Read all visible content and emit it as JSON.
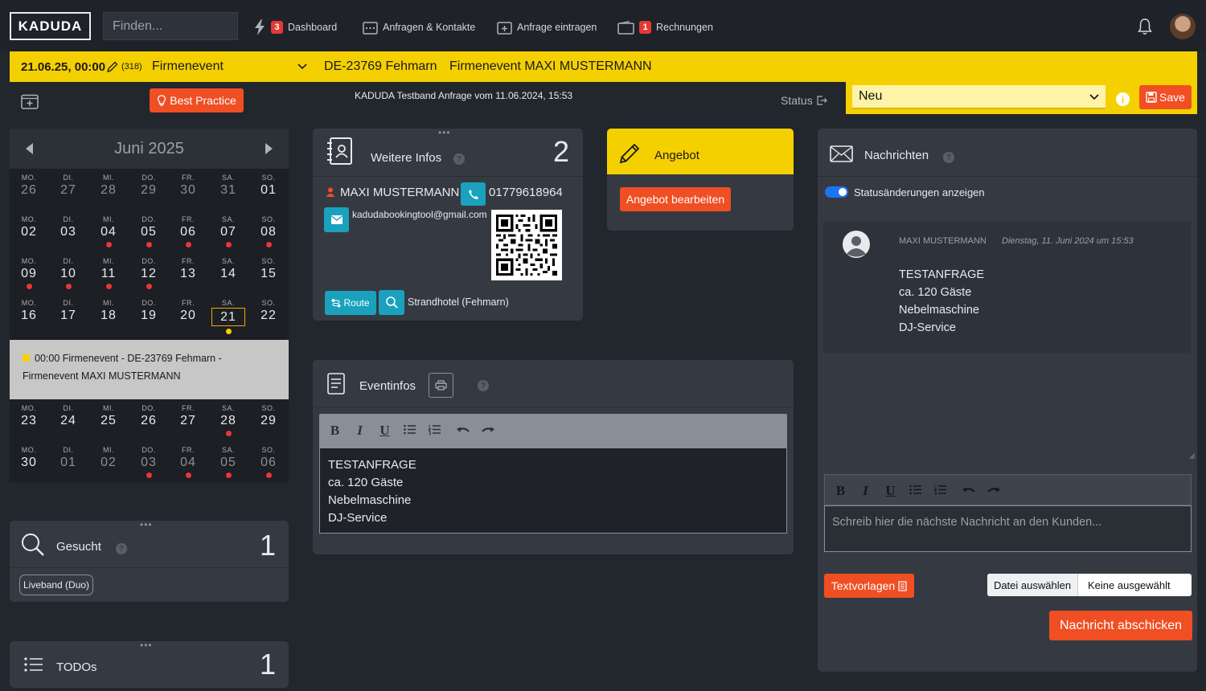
{
  "nav": {
    "logo": "KADUDA",
    "search_placeholder": "Finden...",
    "dashboard_label": "Dashboard",
    "dashboard_badge": "3",
    "anfragen_label": "Anfragen & Kontakte",
    "anfrage_eintragen_label": "Anfrage eintragen",
    "rechnungen_label": "Rechnungen",
    "rechnungen_badge": "1"
  },
  "event_bar": {
    "datetime": "21.06.25, 00:00",
    "count": "(318)",
    "type": "Firmenevent",
    "location": "DE-23769 Fehmarn",
    "title": "Firmenevent MAXI MUSTERMANN"
  },
  "subrow": {
    "best_practice": "Best Practice",
    "subtitle": "KADUDA Testband Anfrage vom 11.06.2024, 15:53",
    "status_label": "Status",
    "status_value": "Neu",
    "save_label": "Save",
    "info": "i"
  },
  "calendar": {
    "month": "Juni 2025",
    "weekdays": [
      "MO.",
      "DI.",
      "MI.",
      "DO.",
      "FR.",
      "SA.",
      "SO."
    ],
    "weeks": [
      [
        {
          "d": "26",
          "dim": true
        },
        {
          "d": "27",
          "dim": true
        },
        {
          "d": "28",
          "dim": true
        },
        {
          "d": "29",
          "dim": true
        },
        {
          "d": "30",
          "dim": true
        },
        {
          "d": "31",
          "dim": true
        },
        {
          "d": "01"
        }
      ],
      [
        {
          "d": "02"
        },
        {
          "d": "03"
        },
        {
          "d": "04",
          "dot": true
        },
        {
          "d": "05",
          "dot": true
        },
        {
          "d": "06",
          "dot": true
        },
        {
          "d": "07",
          "dot": true
        },
        {
          "d": "08",
          "dot": true
        }
      ],
      [
        {
          "d": "09",
          "dot": true
        },
        {
          "d": "10",
          "dot": true
        },
        {
          "d": "11",
          "dot": true
        },
        {
          "d": "12",
          "dot": true
        },
        {
          "d": "13"
        },
        {
          "d": "14"
        },
        {
          "d": "15"
        }
      ],
      [
        {
          "d": "16"
        },
        {
          "d": "17"
        },
        {
          "d": "18"
        },
        {
          "d": "19"
        },
        {
          "d": "20"
        },
        {
          "d": "21",
          "today": true,
          "ydot": true
        },
        {
          "d": "22"
        }
      ],
      [
        {
          "d": "23"
        },
        {
          "d": "24"
        },
        {
          "d": "25"
        },
        {
          "d": "26"
        },
        {
          "d": "27"
        },
        {
          "d": "28",
          "dot": true
        },
        {
          "d": "29"
        }
      ],
      [
        {
          "d": "30"
        },
        {
          "d": "01",
          "dim": true
        },
        {
          "d": "02",
          "dim": true
        },
        {
          "d": "03",
          "dim": true,
          "dot": true
        },
        {
          "d": "04",
          "dim": true,
          "dot": true
        },
        {
          "d": "05",
          "dim": true,
          "dot": true
        },
        {
          "d": "06",
          "dim": true,
          "dot": true
        }
      ]
    ],
    "event_line1": "00:00 Firmenevent - DE-23769 Fehmarn -",
    "event_line2": "Firmenevent MAXI MUSTERMANN"
  },
  "gesucht": {
    "title": "Gesucht",
    "count": "1",
    "tag": "Liveband (Duo)"
  },
  "todos": {
    "title": "TODOs",
    "count": "1"
  },
  "weitere": {
    "title": "Weitere Infos",
    "count": "2",
    "name": "MAXI MUSTERMANN",
    "phone": "01779618964",
    "email": "kadudabookingtool@gmail.com",
    "route_label": "Route",
    "venue": "Strandhotel (Fehmarn)"
  },
  "angebot": {
    "title": "Angebot",
    "edit_label": "Angebot bearbeiten"
  },
  "eventinfos": {
    "title": "Eventinfos",
    "lines": [
      "TESTANFRAGE",
      "ca. 120 Gäste",
      "Nebelmaschine",
      "DJ-Service"
    ]
  },
  "nachrichten": {
    "title": "Nachrichten",
    "toggle_label": "Statusänderungen anzeigen",
    "msg_author": "MAXI MUSTERMANN",
    "msg_date": "Dienstag, 11. Juni 2024 um 15:53",
    "msg_lines": [
      "TESTANFRAGE",
      "ca. 120 Gäste",
      "Nebelmaschine",
      "DJ-Service"
    ],
    "input_placeholder": "Schreib hier die nächste Nachricht an den Kunden...",
    "textvorlagen_label": "Textvorlagen",
    "file_button": "Datei auswählen",
    "file_status": "Keine ausgewählt",
    "send_label": "Nachricht abschicken"
  },
  "colors": {
    "accent_yellow": "#f5d000",
    "accent_orange": "#f04e23",
    "teal": "#1aa1bd",
    "badge_red": "#e53935"
  }
}
